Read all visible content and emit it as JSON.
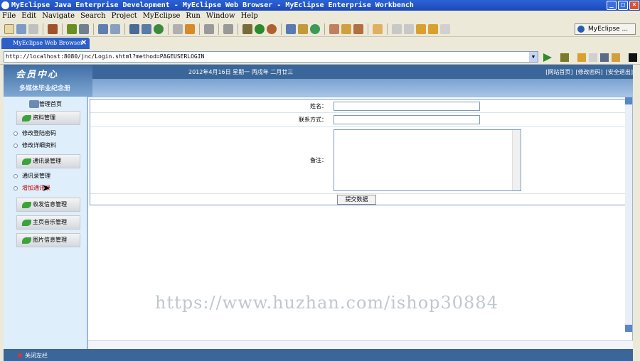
{
  "window": {
    "title": "MyEclipse Java Enterprise Development - MyEclipse Web Browser - MyEclipse Enterprise Workbench"
  },
  "menubar": [
    "File",
    "Edit",
    "Navigate",
    "Search",
    "Project",
    "MyEclipse",
    "Run",
    "Window",
    "Help"
  ],
  "perspective": "MyEclipse ...",
  "browser_tab": {
    "label": "MyEclipse Web Browser"
  },
  "address": {
    "url": "http://localhost:8080/jnc/Login.shtml?method=PAGEUSERLOGIN"
  },
  "site": {
    "logo": "会员中心",
    "subtitle": "多媒体毕业纪念册",
    "date": "2012年4月16日 星期一 丙戌年 二月廿三",
    "links": [
      "[网站首页]",
      "[修改密码]",
      "[安全退出]"
    ]
  },
  "sidebar": {
    "home": "管理首页",
    "groups": [
      {
        "title": "资料管理",
        "items": [
          "修改登陆密码",
          "修改详细资料"
        ]
      },
      {
        "title": "通讯录管理",
        "items": [
          "通讯录管理",
          "增加通讯录"
        ]
      },
      {
        "title": "收发信息管理",
        "items": []
      },
      {
        "title": "主页音乐管理",
        "items": []
      },
      {
        "title": "图片信息管理",
        "items": []
      }
    ]
  },
  "form": {
    "name_label": "姓名：",
    "contact_label": "联系方式：",
    "remark_label": "备注：",
    "submit": "提交数据",
    "name_value": "",
    "contact_value": "",
    "remark_value": ""
  },
  "footer": {
    "close": "关闭左栏"
  },
  "watermark": "https://www.huzhan.com/ishop30884"
}
